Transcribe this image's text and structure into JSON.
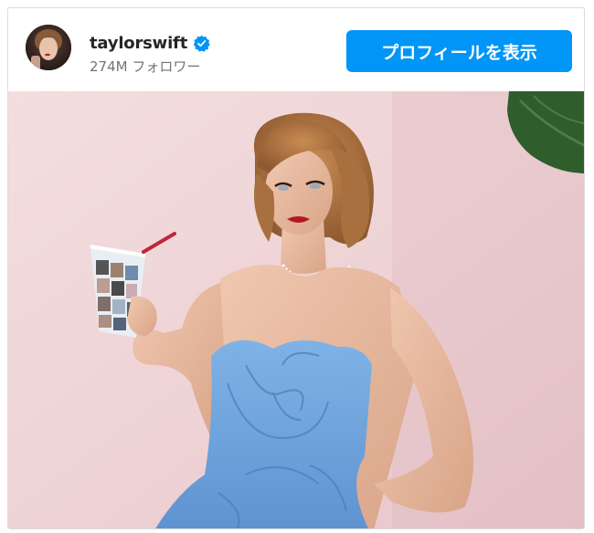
{
  "post": {
    "username": "taylorswift",
    "verified": true,
    "followers": "274M フォロワー",
    "profile_button_label": "プロフィールを表示"
  },
  "icons": {
    "verified": "verified-badge-icon"
  },
  "colors": {
    "accent": "#0095f6",
    "verified": "#0095f6",
    "username": "#262626",
    "secondary_text": "#737373",
    "border": "#dbdbdb"
  }
}
